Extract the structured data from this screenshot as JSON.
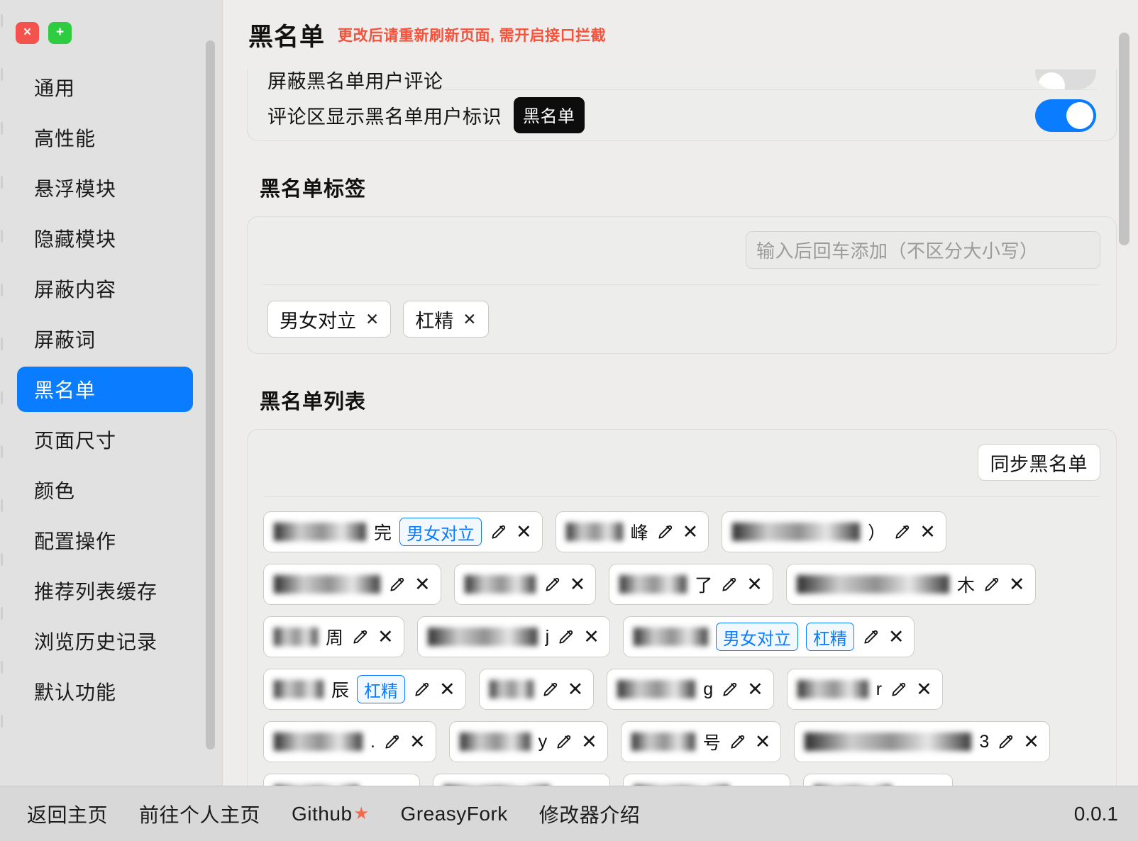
{
  "window": {
    "close_label": "×",
    "add_label": "+",
    "close_icon": "close-icon",
    "add_icon": "plus-icon"
  },
  "sidebar": {
    "items": [
      {
        "label": "通用",
        "active": false
      },
      {
        "label": "高性能",
        "active": false
      },
      {
        "label": "悬浮模块",
        "active": false
      },
      {
        "label": "隐藏模块",
        "active": false
      },
      {
        "label": "屏蔽内容",
        "active": false
      },
      {
        "label": "屏蔽词",
        "active": false
      },
      {
        "label": "黑名单",
        "active": true
      },
      {
        "label": "页面尺寸",
        "active": false
      },
      {
        "label": "颜色",
        "active": false
      },
      {
        "label": "配置操作",
        "active": false
      },
      {
        "label": "推荐列表缓存",
        "active": false
      },
      {
        "label": "浏览历史记录",
        "active": false
      },
      {
        "label": "默认功能",
        "active": false
      }
    ]
  },
  "header": {
    "title": "黑名单",
    "warning": "更改后请重新刷新页面, 需开启接口拦截"
  },
  "toggles": {
    "clipped_row_label": "屏蔽黑名单用户评论",
    "clipped_row_state": "off",
    "row": {
      "label": "评论区显示黑名单用户标识",
      "badge": "黑名单",
      "state": "on"
    }
  },
  "tags_section": {
    "title": "黑名单标签",
    "input_placeholder": "输入后回车添加（不区分大小写）",
    "input_value": "",
    "chips": [
      {
        "label": "男女对立",
        "remove": "✕"
      },
      {
        "label": "杠精",
        "remove": "✕"
      }
    ]
  },
  "list_section": {
    "title": "黑名单列表",
    "sync_button": "同步黑名单",
    "edit_icon": "pencil-icon",
    "delete_icon": "close-icon",
    "delete_glyph": "✕",
    "rows": [
      [
        {
          "name_width": 130,
          "name_suffix": "完",
          "tags": [
            "男女对立"
          ]
        },
        {
          "name_width": 80,
          "name_suffix": "峰",
          "tags": []
        },
        {
          "name_width": 180,
          "name_suffix": "）",
          "tags": []
        }
      ],
      [
        {
          "name_width": 150,
          "name_suffix": "",
          "tags": []
        },
        {
          "name_width": 100,
          "name_suffix": "",
          "tags": []
        },
        {
          "name_width": 95,
          "name_suffix": "了",
          "tags": []
        },
        {
          "name_width": 215,
          "name_suffix": "木",
          "tags": []
        }
      ],
      [
        {
          "name_width": 62,
          "name_suffix": "周",
          "tags": []
        },
        {
          "name_width": 155,
          "name_suffix": "j",
          "tags": []
        },
        {
          "name_width": 105,
          "name_suffix": "",
          "tags": [
            "男女对立",
            "杠精"
          ]
        }
      ],
      [
        {
          "name_width": 70,
          "name_suffix": "辰",
          "tags": [
            "杠精"
          ]
        },
        {
          "name_width": 62,
          "name_suffix": "",
          "tags": []
        },
        {
          "name_width": 110,
          "name_suffix": "g",
          "tags": []
        },
        {
          "name_width": 100,
          "name_suffix": "r",
          "tags": []
        }
      ],
      [
        {
          "name_width": 125,
          "name_suffix": ".",
          "tags": []
        },
        {
          "name_width": 100,
          "name_suffix": "y",
          "tags": []
        },
        {
          "name_width": 90,
          "name_suffix": "号",
          "tags": []
        },
        {
          "name_width": 235,
          "name_suffix": "3",
          "tags": []
        }
      ],
      [
        {
          "name_width": 120,
          "name_suffix": "",
          "tags": []
        },
        {
          "name_width": 150,
          "name_suffix": "",
          "tags": []
        },
        {
          "name_width": 135,
          "name_suffix": "",
          "tags": []
        },
        {
          "name_width": 110,
          "name_suffix": "",
          "tags": []
        }
      ]
    ]
  },
  "footer": {
    "links": [
      {
        "label": "返回主页",
        "star": false
      },
      {
        "label": "前往个人主页",
        "star": false
      },
      {
        "label": "Github",
        "star": true
      },
      {
        "label": "GreasyFork",
        "star": false
      },
      {
        "label": "修改器介绍",
        "star": false
      }
    ],
    "star_glyph": "★",
    "version": "0.0.1"
  },
  "colors": {
    "accent": "#0a7cff",
    "warning": "#f5523b",
    "close": "#f4524d",
    "add": "#2ecc40",
    "badge_dark": "#0d0d0d"
  }
}
